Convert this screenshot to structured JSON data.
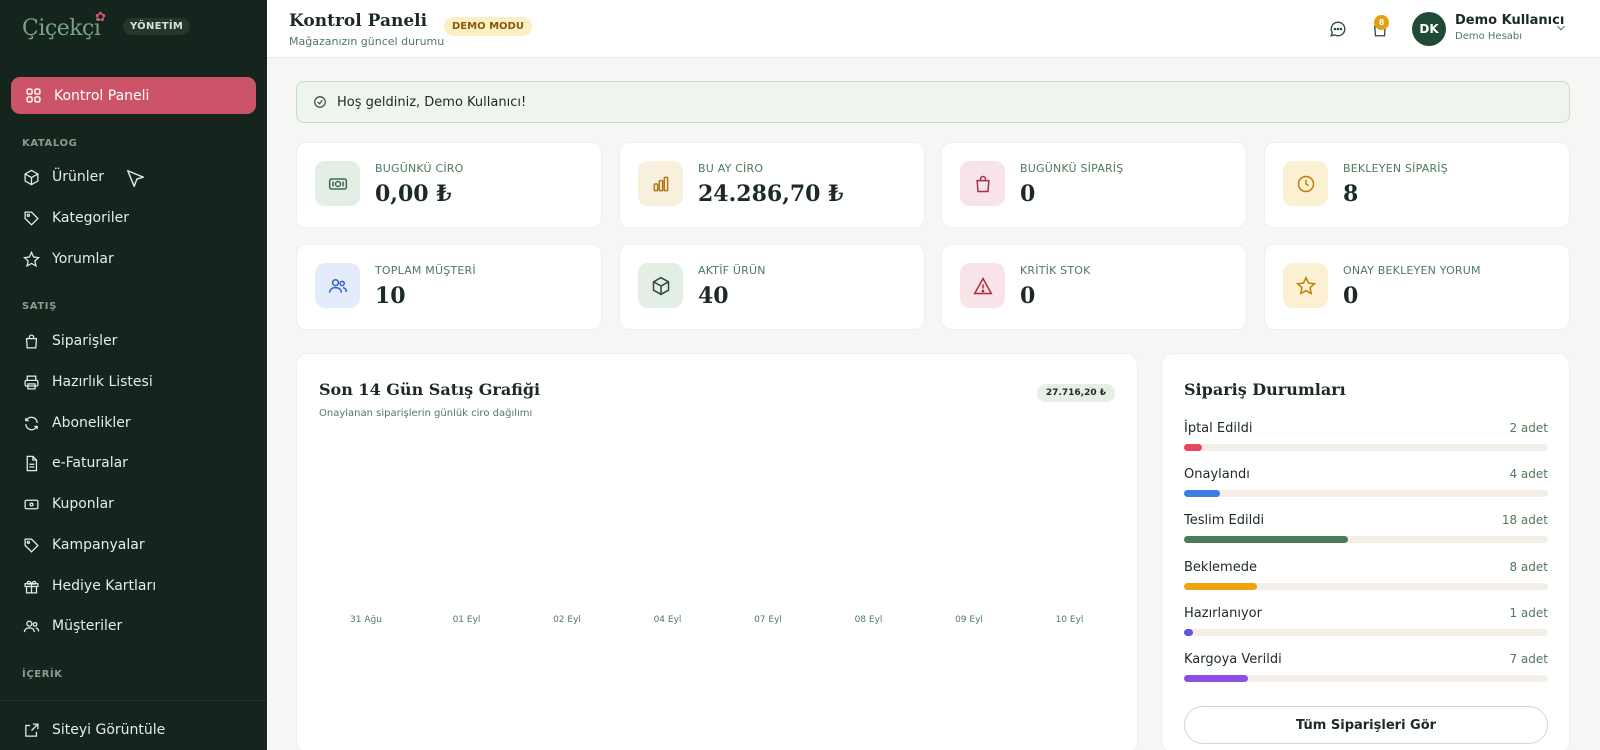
{
  "brand": {
    "logo_text": "Çiçekçi",
    "admin_badge": "YÖNETİM"
  },
  "sidebar": {
    "active": {
      "label": "Kontrol Paneli",
      "icon": "grid-icon"
    },
    "sections": [
      {
        "title": "KATALOG",
        "items": [
          {
            "label": "Ürünler",
            "icon": "box-icon"
          },
          {
            "label": "Kategoriler",
            "icon": "tag-icon"
          },
          {
            "label": "Yorumlar",
            "icon": "star-icon"
          }
        ]
      },
      {
        "title": "SATIŞ",
        "items": [
          {
            "label": "Siparişler",
            "icon": "bag-icon"
          },
          {
            "label": "Hazırlık Listesi",
            "icon": "printer-icon"
          },
          {
            "label": "Abonelikler",
            "icon": "refresh-icon"
          },
          {
            "label": "e-Faturalar",
            "icon": "document-icon"
          },
          {
            "label": "Kuponlar",
            "icon": "ticket-icon"
          },
          {
            "label": "Kampanyalar",
            "icon": "tag-icon"
          },
          {
            "label": "Hediye Kartları",
            "icon": "gift-icon"
          },
          {
            "label": "Müşteriler",
            "icon": "users-icon"
          }
        ]
      },
      {
        "title": "İÇERİK",
        "items": []
      }
    ],
    "footer_link": {
      "label": "Siteyi Görüntüle",
      "icon": "external-link-icon"
    }
  },
  "header": {
    "title": "Kontrol Paneli",
    "subtitle": "Mağazanızın güncel durumu",
    "demo_badge": "DEMO MODU",
    "notification_count": "8",
    "user": {
      "initials": "DK",
      "name": "Demo Kullanıcı",
      "role": "Demo Hesabı"
    }
  },
  "welcome": {
    "message": "Hoş geldiniz, Demo Kullanıcı!"
  },
  "stats": [
    {
      "label": "BUGÜNKÜ CİRO",
      "value": "0,00 ₺",
      "icon": "cash-icon",
      "color": "#e3eee4"
    },
    {
      "label": "BU AY CİRO",
      "value": "24.286,70 ₺",
      "icon": "bar-chart-icon",
      "color": "#f8efdd"
    },
    {
      "label": "BUGÜNKÜ SİPARİŞ",
      "value": "0",
      "icon": "bag-icon",
      "color": "#f8e4e8"
    },
    {
      "label": "BEKLEYEN SİPARİŞ",
      "value": "8",
      "icon": "clock-icon",
      "color": "#fbf1d2"
    },
    {
      "label": "TOPLAM MÜŞTERİ",
      "value": "10",
      "icon": "users-icon",
      "color": "#e4ecfb"
    },
    {
      "label": "AKTİF ÜRÜN",
      "value": "40",
      "icon": "box-icon",
      "color": "#e3eee4"
    },
    {
      "label": "KRİTİK STOK",
      "value": "0",
      "icon": "warning-icon",
      "color": "#f8e4e8"
    },
    {
      "label": "ONAY BEKLEYEN YORUM",
      "value": "0",
      "icon": "star-icon",
      "color": "#fbf1d2"
    }
  ],
  "sales_chart": {
    "title": "Son 14 Gün Satış Grafiği",
    "subtitle": "Onaylanan siparişlerin günlük ciro dağılımı",
    "total": "27.716,20 ₺"
  },
  "chart_data": {
    "type": "bar",
    "title": "Son 14 Gün Satış Grafiği",
    "categories": [
      "31 Ağu",
      "01 Eyl",
      "02 Eyl",
      "04 Eyl",
      "07 Eyl",
      "08 Eyl",
      "09 Eyl",
      "10 Eyl"
    ],
    "values": [],
    "xlabel": "",
    "ylabel": "",
    "grid": false
  },
  "order_status": {
    "title": "Sipariş Durumları",
    "items": [
      {
        "label": "İptal Edildi",
        "count": "2 adet",
        "value": 2,
        "color": "#e8485f"
      },
      {
        "label": "Onaylandı",
        "count": "4 adet",
        "value": 4,
        "color": "#3b7de0"
      },
      {
        "label": "Teslim Edildi",
        "count": "18 adet",
        "value": 18,
        "color": "#4a7c59"
      },
      {
        "label": "Beklemede",
        "count": "8 adet",
        "value": 8,
        "color": "#f0a30a"
      },
      {
        "label": "Hazırlanıyor",
        "count": "1 adet",
        "value": 1,
        "color": "#5d55e0"
      },
      {
        "label": "Kargoya Verildi",
        "count": "7 adet",
        "value": 7,
        "color": "#8b4fe6"
      }
    ],
    "max_value": 40,
    "button_label": "Tüm Siparişleri Gör"
  }
}
